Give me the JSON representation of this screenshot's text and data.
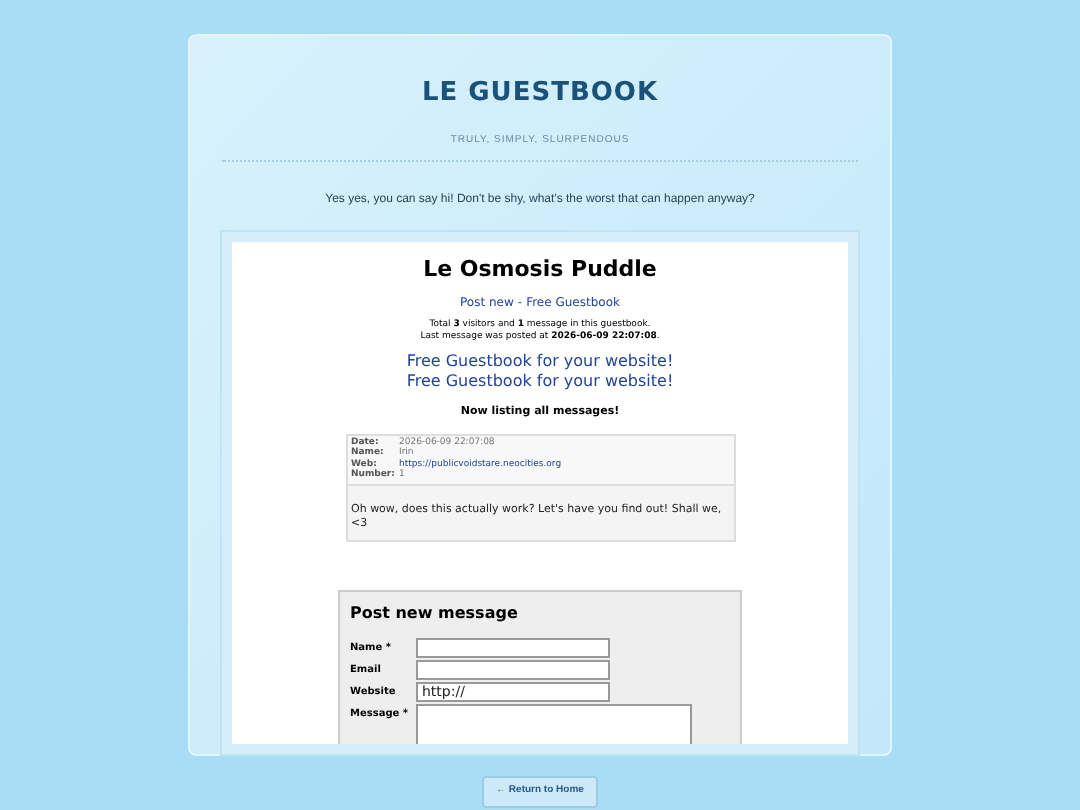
{
  "header": {
    "title": "LE GUESTBOOK",
    "tagline": "TRULY, SIMPLY, SLURPENDOUS"
  },
  "intro": "Yes yes, you can say hi! Don't be shy, what's the worst that can happen anyway?",
  "guestbook": {
    "title": "Le Osmosis Puddle",
    "nav": [
      "Post new",
      "-",
      "Free Guestbook"
    ],
    "stats": [
      "Total **3** visitors and **1** message in this guestbook.",
      "Last message was posted at **2026-06-09 22:07:08**."
    ],
    "promo_links": [
      "Free Guestbook for your website!",
      "Free Guestbook for your website!"
    ],
    "listing_heading": "Now listing all messages!",
    "entries": [
      {
        "fields": [
          {
            "label": "Date:",
            "value": "2026-06-09 22:07:08",
            "kind": "text"
          },
          {
            "label": "Name:",
            "value": "Irin",
            "kind": "text"
          },
          {
            "label": "Web:",
            "value": "https://publicvoidstare.neocities.org",
            "kind": "link"
          },
          {
            "label": "Number:",
            "value": "1",
            "kind": "text"
          }
        ],
        "message": "Oh wow, does this actually work? Let's have you find out! Shall we, <3"
      }
    ],
    "form": {
      "title": "Post new message",
      "fields": [
        {
          "label": "Name *",
          "kind": "input"
        },
        {
          "label": "Email",
          "kind": "input"
        },
        {
          "label": "Website",
          "kind": "input",
          "value": "http://"
        },
        {
          "label": "Message *",
          "kind": "textarea"
        }
      ]
    }
  },
  "return_button": "← Return to Home"
}
